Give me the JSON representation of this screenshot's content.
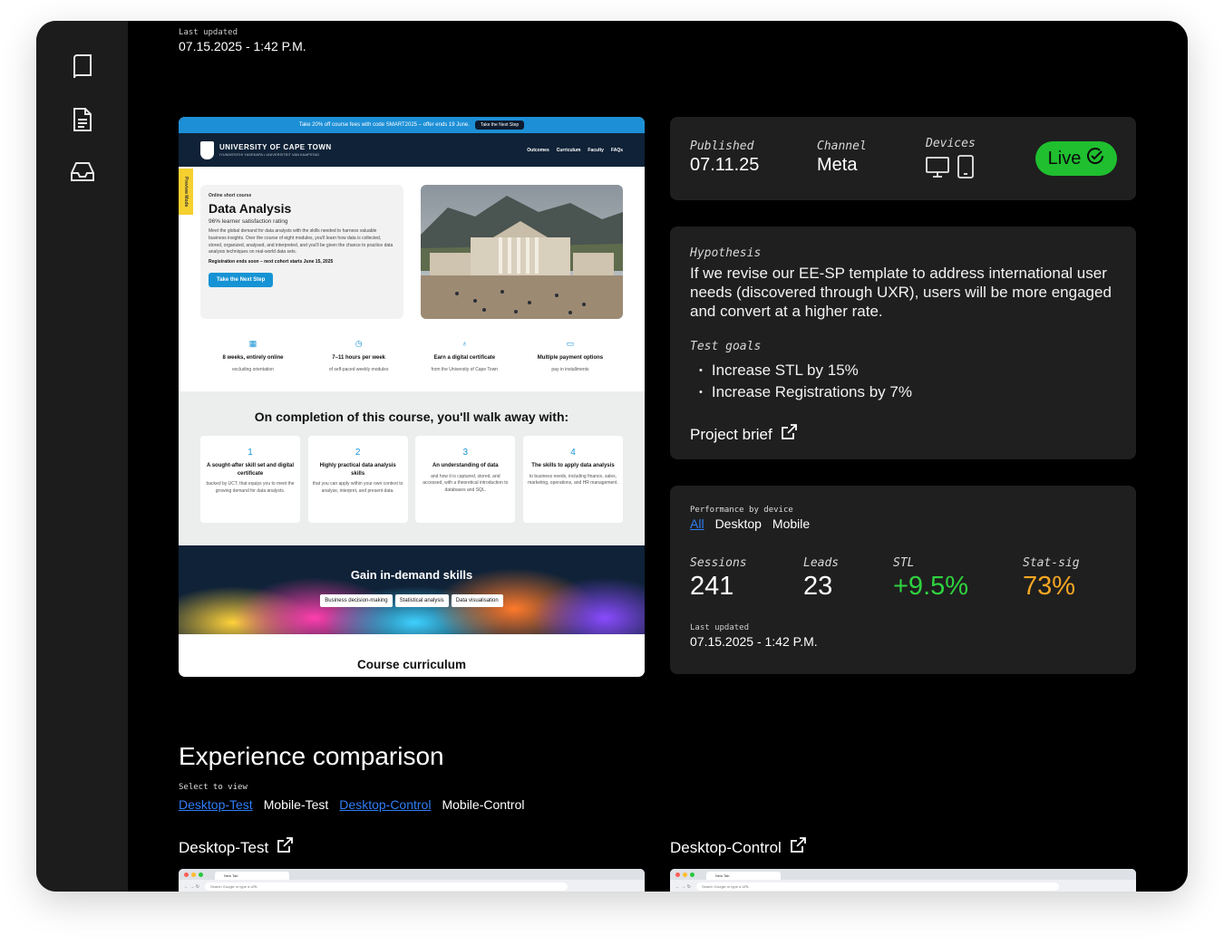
{
  "sidebar": {
    "icons": [
      "book-icon",
      "document-icon",
      "inbox-icon"
    ]
  },
  "top_updated": {
    "label": "Last updated",
    "value": "07.15.2025 - 1:42 P.M."
  },
  "preview": {
    "promo_text": "Take 20% off course fees with code SMART2025 – offer ends 19 June.",
    "promo_button": "Take the Next Step",
    "brand_name": "UNIVERSITY OF CAPE TOWN",
    "brand_sub": "IYUNIVESITHI YASEKAPA • UNIVERSITEIT VAN KAAPSTAD",
    "nav": [
      "Outcomes",
      "Curriculum",
      "Faculty",
      "FAQs"
    ],
    "preview_mode": "Preview Mode",
    "hero": {
      "kicker": "Online short course",
      "title": "Data Analysis",
      "rating": "96% learner satisfaction rating",
      "description": "Meet the global demand for data analysts with the skills needed to harness valuable business insights. Over the course of eight modules, you'll learn how data is collected, stored, organized, analysed, and interpreted, and you'll be given the chance to practice data analysis techniques on real-world data sets.",
      "registration": "Registration ends soon – next cohort starts June 15, 2025",
      "cta": "Take the Next Step"
    },
    "features": [
      {
        "title": "8 weeks, entirely online",
        "sub": "excluding orientation"
      },
      {
        "title": "7–11 hours per week",
        "sub": "of self-paced weekly modules"
      },
      {
        "title": "Earn a digital certificate",
        "sub": "from the University of Cape Town"
      },
      {
        "title": "Multiple payment options",
        "sub": "pay in installments"
      }
    ],
    "completion_title": "On completion of this course, you'll walk away with:",
    "outcomes": [
      {
        "num": "1",
        "title": "A sought-after skill set and digital certificate",
        "sub": "backed by UCT, that equips you to meet the growing demand for data analysts."
      },
      {
        "num": "2",
        "title": "Highly practical data analysis skills",
        "sub": "that you can apply within your own context to analyse, interpret, and present data."
      },
      {
        "num": "3",
        "title": "An understanding of data",
        "sub": "and how it is captured, stored, and accessed, with a theoretical introduction to databases and SQL."
      },
      {
        "num": "4",
        "title": "The skills to apply data analysis",
        "sub": "to business needs, including finance, sales, marketing, operations, and HR management."
      }
    ],
    "skills_title": "Gain in-demand skills",
    "skills": [
      "Business decision-making",
      "Statistical analysis",
      "Data visualisation"
    ],
    "curriculum_title": "Course curriculum"
  },
  "meta_panel": {
    "published_label": "Published",
    "published_value": "07.11.25",
    "channel_label": "Channel",
    "channel_value": "Meta",
    "devices_label": "Devices",
    "status": "Live",
    "status_color": "#1fbf2f"
  },
  "hypothesis_panel": {
    "hypothesis_label": "Hypothesis",
    "hypothesis_text": "If we revise our EE-SP template to address international user needs (discovered through UXR), users will be more engaged and convert at a higher rate.",
    "goals_label": "Test goals",
    "goals": [
      "Increase STL by 15%",
      "Increase Registrations by 7%"
    ],
    "brief_label": "Project brief"
  },
  "performance_panel": {
    "label": "Performance by device",
    "tabs": [
      "All",
      "Desktop",
      "Mobile"
    ],
    "selected_tab": "All",
    "metrics": [
      {
        "label": "Sessions",
        "value": "241"
      },
      {
        "label": "Leads",
        "value": "23"
      },
      {
        "label": "STL",
        "value": "+9.5%",
        "color": "#2fd33f"
      },
      {
        "label": "Stat-sig",
        "value": "73%",
        "color": "#f5a623"
      }
    ],
    "updated_label": "Last updated",
    "updated_value": "07.15.2025 - 1:42 P.M."
  },
  "comparison": {
    "title": "Experience comparison",
    "select_label": "Select to view",
    "tabs": [
      "Desktop-Test",
      "Mobile-Test",
      "Desktop-Control",
      "Mobile-Control"
    ],
    "selected_tabs": [
      "Desktop-Test",
      "Desktop-Control"
    ],
    "left_heading": "Desktop-Test",
    "right_heading": "Desktop-Control",
    "browser_tab_title": "New Tab",
    "browser_url_placeholder": "Search Google or type a URL"
  },
  "colors": {
    "accent": "#2f7ef6",
    "background": "#000000",
    "panel": "#1f1f1f"
  }
}
